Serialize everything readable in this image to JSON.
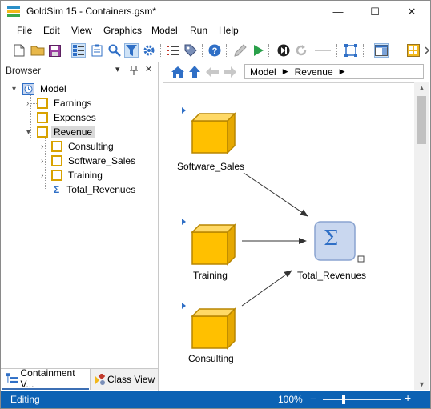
{
  "window": {
    "title": "GoldSim 15  -  Containers.gsm*",
    "minimize_glyph": "—",
    "maximize_glyph": "☐",
    "close_glyph": "✕"
  },
  "menu": {
    "items": [
      "File",
      "Edit",
      "View",
      "Graphics",
      "Model",
      "Run",
      "Help"
    ]
  },
  "browser": {
    "title": "Browser",
    "pin_glyph": "▾",
    "autohide_glyph": "📌",
    "close_glyph": "✕",
    "tree": {
      "root": "Model",
      "earnings": "Earnings",
      "expenses": "Expenses",
      "revenue": "Revenue",
      "consulting": "Consulting",
      "software_sales": "Software_Sales",
      "training": "Training",
      "total_revenues": "Total_Revenues",
      "sum_glyph": "Σ"
    },
    "tabs": {
      "containment": "Containment V...",
      "class_view": "Class View"
    }
  },
  "nav": {
    "breadcrumb": [
      "Model",
      "Revenue"
    ],
    "sep_glyph": "▶"
  },
  "canvas": {
    "nodes": {
      "software_sales": "Software_Sales",
      "training": "Training",
      "consulting": "Consulting",
      "total_revenues": "Total_Revenues"
    },
    "sum_glyph": "Σ"
  },
  "status": {
    "mode": "Editing",
    "zoom": "100%",
    "zoom_minus": "−",
    "zoom_plus": "+"
  },
  "colors": {
    "status_bar": "#0c62b4",
    "container_fill": "#ffc000",
    "container_border": "#b88600",
    "sum_fill": "#c9d7ef",
    "accent_blue": "#2f6fc6"
  }
}
